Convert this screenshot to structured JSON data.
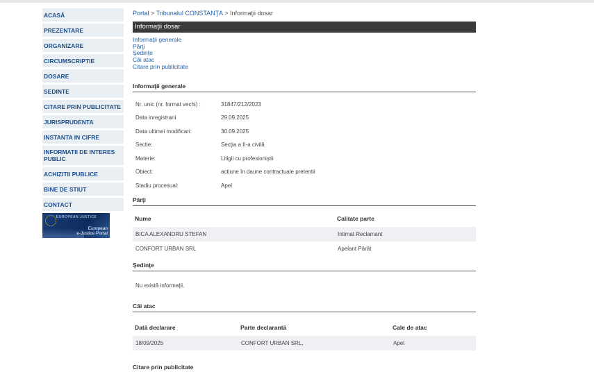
{
  "sidebar": {
    "items": [
      {
        "label": "ACASĂ"
      },
      {
        "label": "PREZENTARE"
      },
      {
        "label": "ORGANIZARE"
      },
      {
        "label": "CIRCUMSCRIPTIE"
      },
      {
        "label": "DOSARE"
      },
      {
        "label": "SEDINTE"
      },
      {
        "label": "CITARE PRIN PUBLICITATE"
      },
      {
        "label": "JURISPRUDENTA"
      },
      {
        "label": "INSTANTA IN CIFRE"
      },
      {
        "label": "INFORMATII DE INTERES PUBLIC"
      },
      {
        "label": "ACHIZITII PUBLICE"
      },
      {
        "label": "BINE DE STIUT"
      },
      {
        "label": "CONTACT"
      }
    ],
    "banner": {
      "small_text": "EUROPEAN JUSTICE",
      "line1": "European",
      "line2": "e-Justice Portal",
      "icon": "eu-stars-icon"
    }
  },
  "breadcrumb": {
    "portal": "Portal",
    "sep": ">",
    "court": "Tribunalul CONSTANŢA",
    "current": "Informaţii dosar"
  },
  "page_title": "Informaţii dosar",
  "anchors": [
    "Informaţii generale",
    "Părţi",
    "Şedinţe",
    "Căi atac",
    "Citare prin publicitate"
  ],
  "general": {
    "title": "Informaţii generale",
    "rows": [
      {
        "label": "Nr. unic (nr. format vechi) :",
        "value": "31847/212/2023"
      },
      {
        "label": "Data inregistrarii",
        "value": "29.09.2025"
      },
      {
        "label": "Data ultimei modificari:",
        "value": "30.09.2025"
      },
      {
        "label": "Sectie:",
        "value": "Secţia a II-a civilă"
      },
      {
        "label": "Materie:",
        "value": "Litigii cu profesioniştii"
      },
      {
        "label": "Obiect:",
        "value": "actiune în daune contractuale pretentii"
      },
      {
        "label": "Stadiu procesual:",
        "value": "Apel"
      }
    ]
  },
  "parti": {
    "title": "Părţi",
    "headers": [
      "Nume",
      "Calitate parte"
    ],
    "rows": [
      [
        "BICA ALEXANDRU STEFAN",
        "Intimat Reclamant"
      ],
      [
        "CONFORT URBAN SRL",
        "Apelant Pârât"
      ]
    ]
  },
  "sedinte": {
    "title": "Şedinţe",
    "empty": "Nu există informaţii."
  },
  "cai_atac": {
    "title": "Căi atac",
    "headers": [
      "Dată declarare",
      "Parte declarantă",
      "Cale de atac"
    ],
    "rows": [
      [
        "18/09/2025",
        "CONFORT URBAN SRL,",
        "Apel"
      ]
    ]
  },
  "citare": {
    "title": "Citare prin publicitate"
  }
}
